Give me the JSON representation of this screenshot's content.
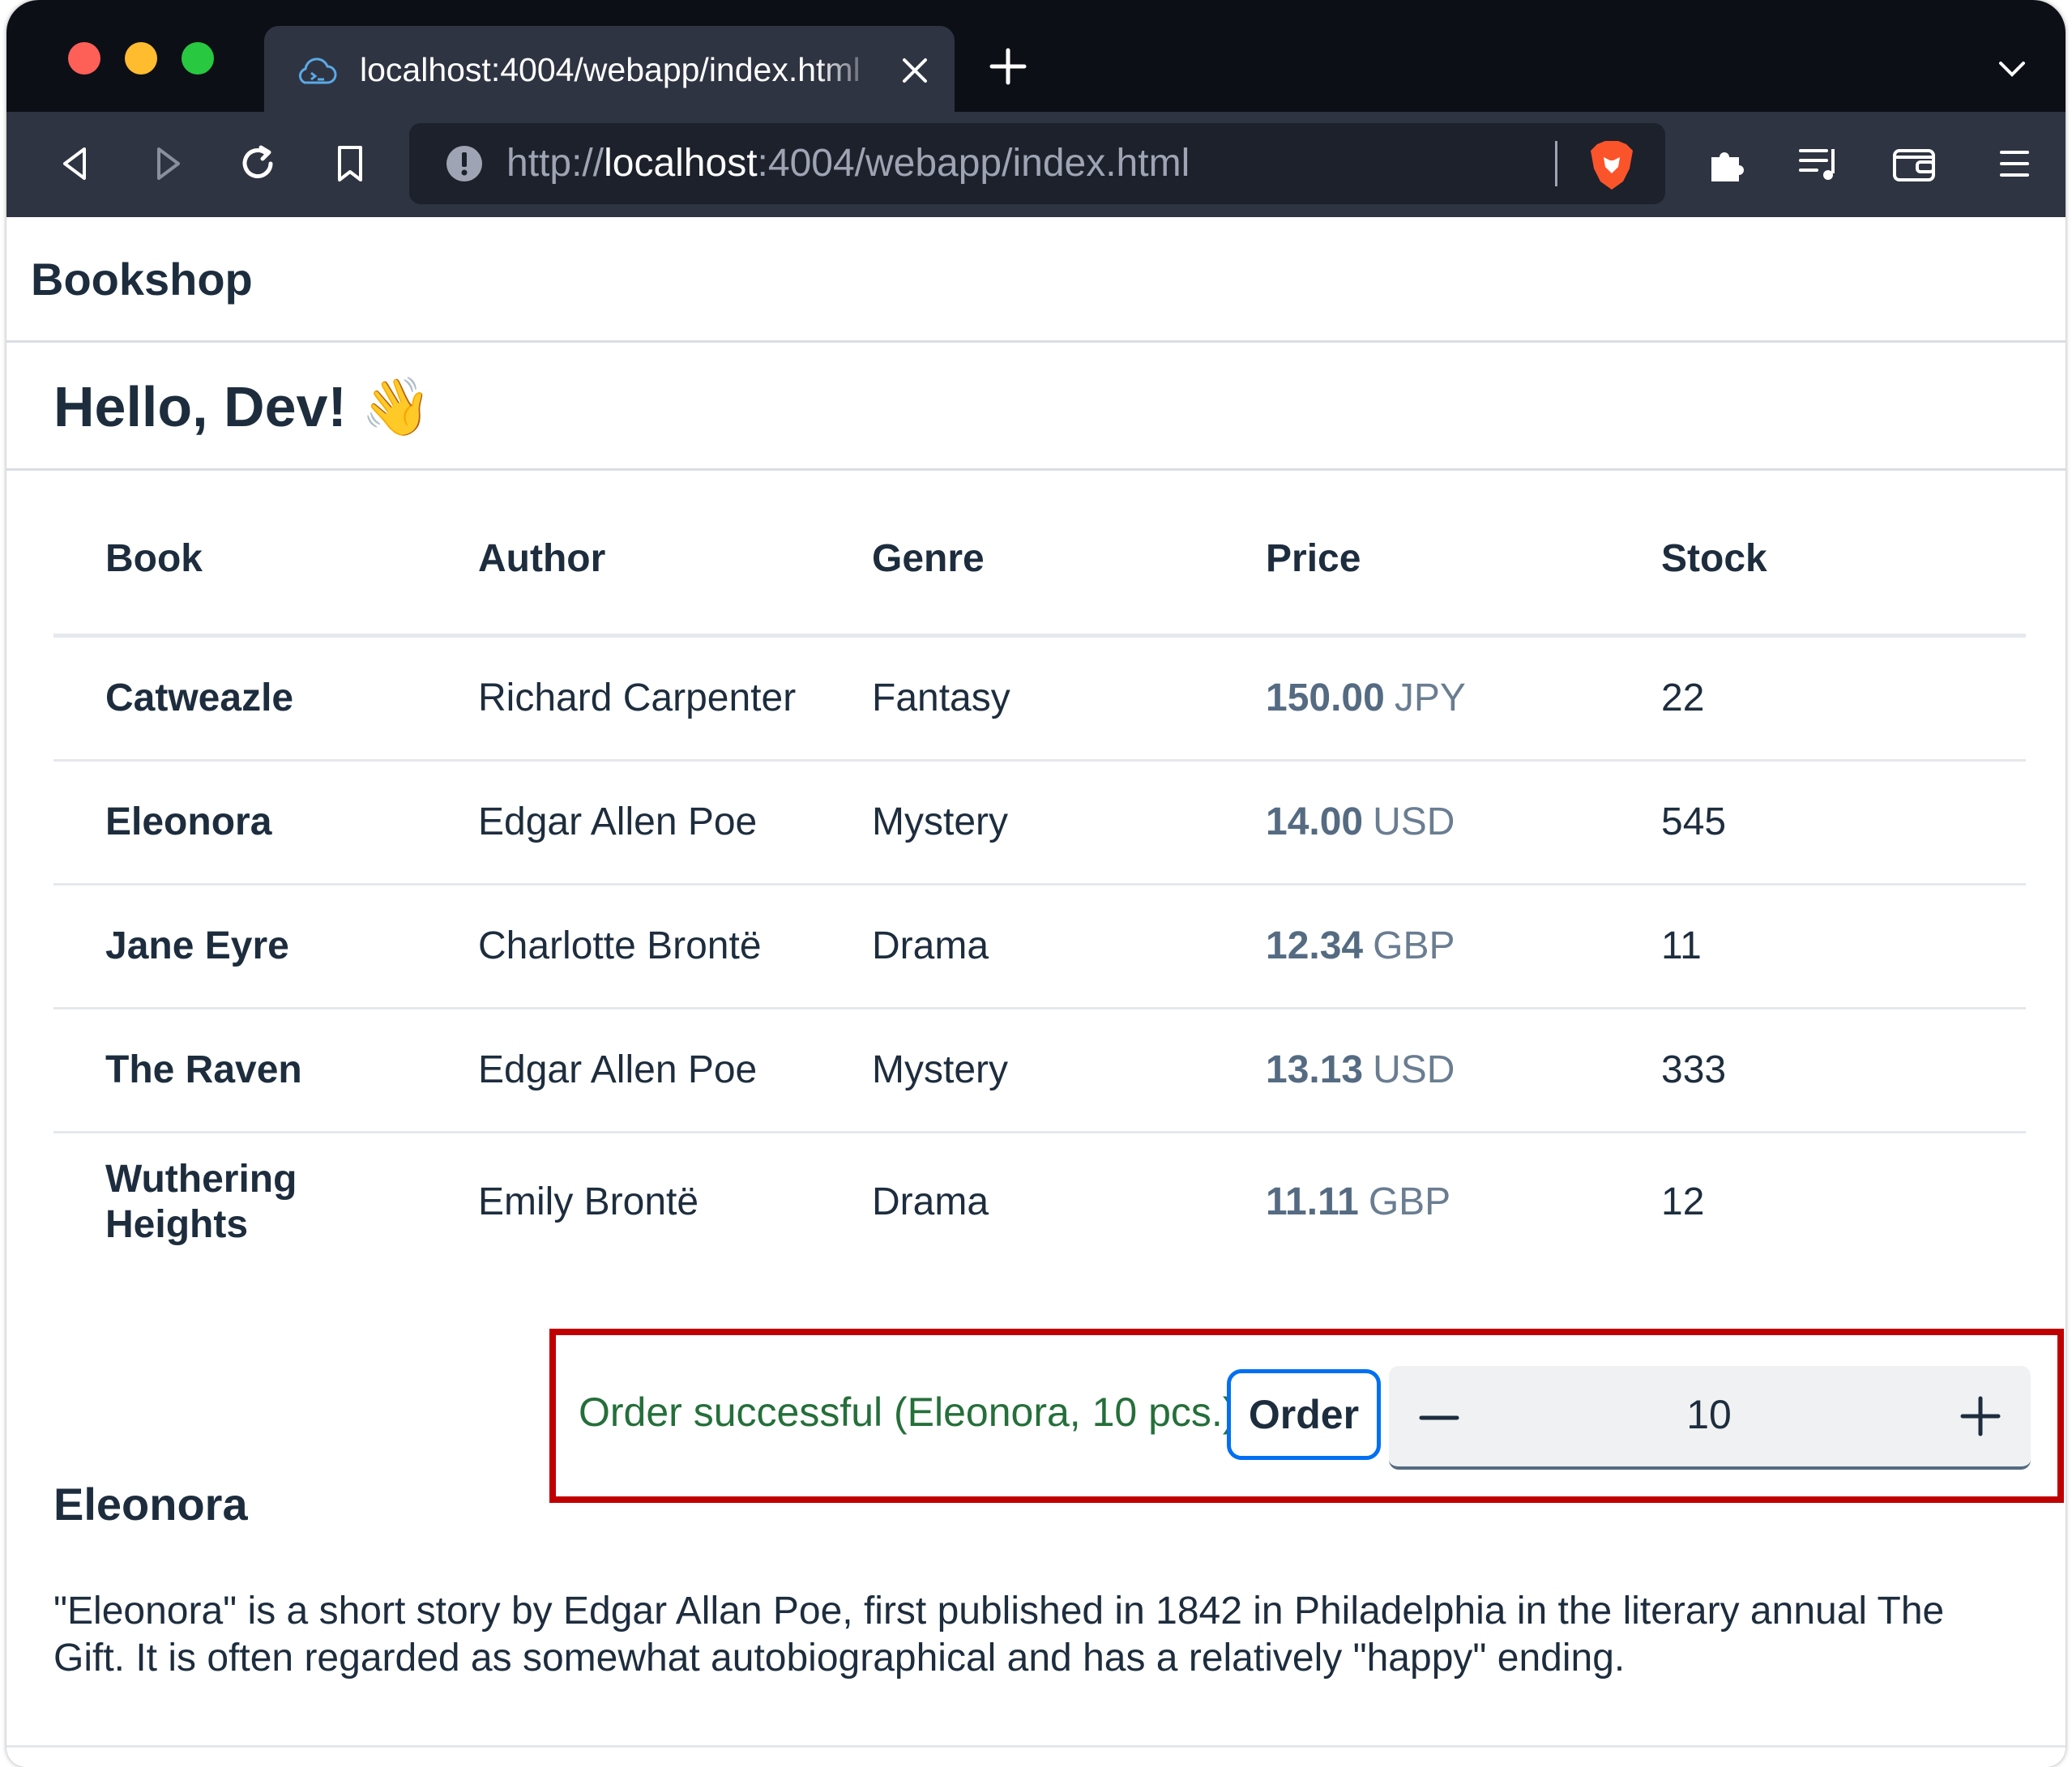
{
  "browser": {
    "tab_title": "localhost:4004/webapp/index.html",
    "url_scheme": "http://",
    "url_host": "localhost",
    "url_rest": ":4004/webapp/index.html"
  },
  "app": {
    "title": "Bookshop"
  },
  "header": {
    "greeting": "Hello, Dev!",
    "greeting_emoji": "👋"
  },
  "table": {
    "columns": [
      "Book",
      "Author",
      "Genre",
      "Price",
      "Stock"
    ],
    "rows": [
      {
        "book": "Catweazle",
        "author": "Richard Carpenter",
        "genre": "Fantasy",
        "price": "150.00",
        "currency": "JPY",
        "stock": "22"
      },
      {
        "book": "Eleonora",
        "author": "Edgar Allen Poe",
        "genre": "Mystery",
        "price": "14.00",
        "currency": "USD",
        "stock": "545"
      },
      {
        "book": "Jane Eyre",
        "author": "Charlotte Brontë",
        "genre": "Drama",
        "price": "12.34",
        "currency": "GBP",
        "stock": "11"
      },
      {
        "book": "The Raven",
        "author": "Edgar Allen Poe",
        "genre": "Mystery",
        "price": "13.13",
        "currency": "USD",
        "stock": "333"
      },
      {
        "book": "Wuthering Heights",
        "author": "Emily Brontë",
        "genre": "Drama",
        "price": "11.11",
        "currency": "GBP",
        "stock": "12"
      }
    ]
  },
  "order": {
    "message": "Order successful (Eleonora, 10 pcs.)",
    "button_label": "Order",
    "quantity": "10"
  },
  "detail": {
    "title": "Eleonora",
    "description": "\"Eleonora\" is a short story by Edgar Allan Poe, first published in 1842 in Philadelphia in the literary annual The Gift. It is often regarded as somewhat autobiographical and has a relatively \"happy\" ending."
  },
  "colors": {
    "accent": "#0070f2",
    "success": "#256f3a",
    "highlight_box": "#c00000",
    "price": "#556b82"
  },
  "icons": {
    "tab": "cloud-icon",
    "close": "close-icon",
    "new_tab": "plus-icon",
    "back": "back-icon",
    "forward": "forward-icon",
    "reload": "reload-icon",
    "bookmark": "bookmark-icon",
    "site_info": "info-icon",
    "brave": "brave-lion-icon",
    "extensions": "puzzle-icon",
    "playlist": "playlist-icon",
    "wallet": "wallet-icon",
    "menu": "hamburger-menu-icon"
  }
}
